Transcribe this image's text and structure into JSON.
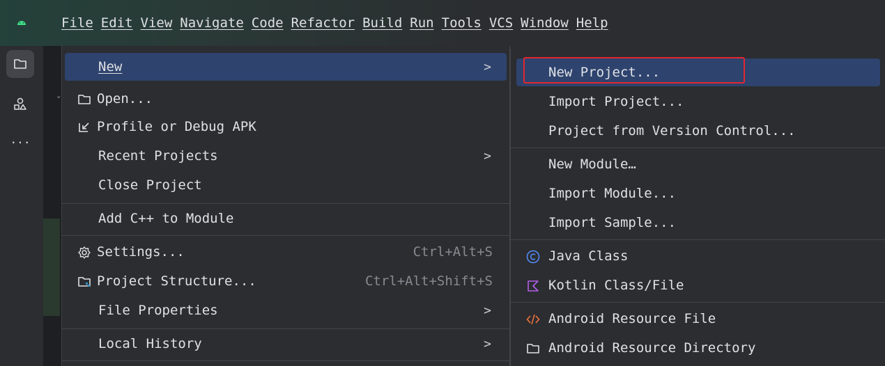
{
  "colors": {
    "accent": "#2e436e",
    "highlight_box": "#e4262d",
    "android_green": "#3ddc84"
  },
  "menubar": {
    "logo_icon": "android-icon",
    "items": [
      "File",
      "Edit",
      "View",
      "Navigate",
      "Code",
      "Refactor",
      "Build",
      "Run",
      "Tools",
      "VCS",
      "Window",
      "Help"
    ]
  },
  "sidebar": {
    "icons": [
      "folder-icon",
      "shapes-icon",
      "more-icon"
    ],
    "more_label": "..."
  },
  "file_menu": {
    "new": "New",
    "open": "Open...",
    "profile": "Profile or Debug APK",
    "recent": "Recent Projects",
    "close": "Close Project",
    "add_cpp": "Add C++ to Module",
    "settings": "Settings...",
    "settings_shortcut": "Ctrl+Alt+S",
    "structure": "Project Structure...",
    "structure_shortcut": "Ctrl+Alt+Shift+S",
    "file_props": "File Properties",
    "local_history": "Local History",
    "arrow": ">"
  },
  "new_submenu": {
    "new_project": "New Project...",
    "import_project": "Import Project...",
    "vcs_project": "Project from Version Control...",
    "new_module": "New Module…",
    "import_module": "Import Module...",
    "import_sample": "Import Sample...",
    "java_class": "Java Class",
    "kotlin_class": "Kotlin Class/File",
    "android_res_file": "Android Resource File",
    "android_res_dir": "Android Resource Directory"
  }
}
